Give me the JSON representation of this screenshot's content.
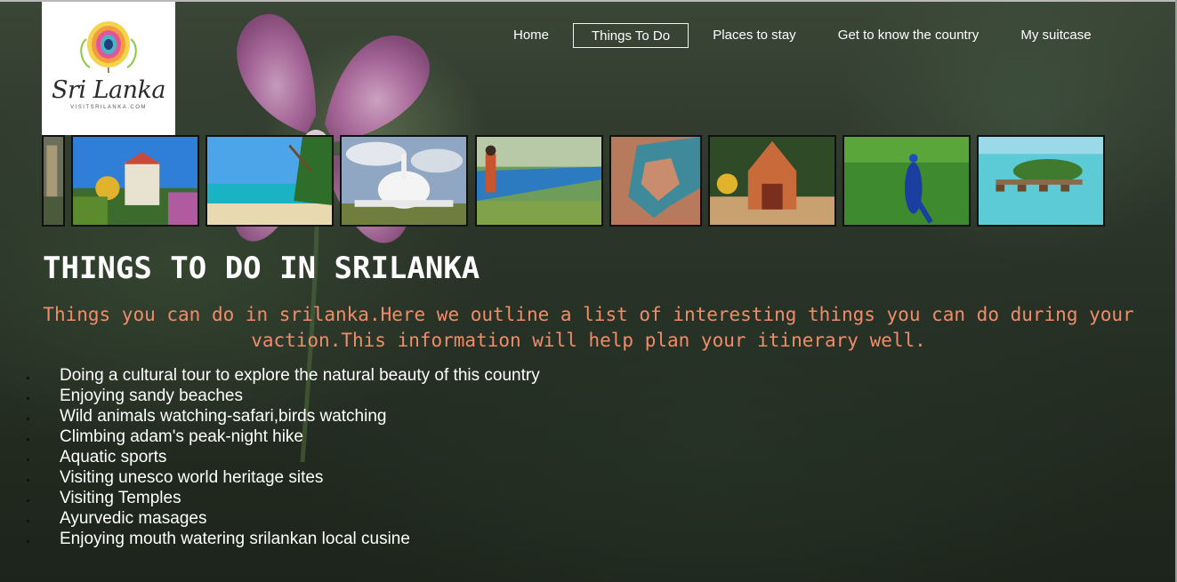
{
  "logo": {
    "brand": "Sri Lanka",
    "url": "VISITSRILANKA.COM",
    "feather_icon": "peacock-feather-icon"
  },
  "nav": {
    "items": [
      {
        "label": "Home",
        "active": false
      },
      {
        "label": "Things To Do",
        "active": true
      },
      {
        "label": "Places to stay",
        "active": false
      },
      {
        "label": "Get to know the country",
        "active": false
      },
      {
        "label": "My suitcase",
        "active": false
      }
    ]
  },
  "gallery": {
    "images": [
      "rock-carving-thumbnail",
      "golden-statue-temple-thumbnail",
      "beach-palms-thumbnail",
      "white-stupa-thumbnail",
      "blue-train-thumbnail",
      "galle-fort-aerial-thumbnail",
      "hindu-temple-thumbnail",
      "peacock-thumbnail",
      "island-resort-thumbnail"
    ]
  },
  "main": {
    "title": "THINGS TO DO IN SRILANKA",
    "intro": "Things you can do in srilanka.Here we outline a list of interesting things you can do during your vaction.This information will help plan your itinerary well.",
    "activities": [
      "Doing a cultural tour to explore the natural beauty of this country",
      "Enjoying sandy beaches",
      "Wild animals watching-safari,birds watching",
      "Climbing adam's peak-night hike",
      "Aquatic sports",
      "Visiting unesco world heritage sites",
      "Visiting Temples",
      "Ayurvedic masages",
      "Enjoying mouth watering srilankan local cusine"
    ]
  },
  "colors": {
    "accent_text": "#f08c6a",
    "title_text": "#ffffff",
    "background": "#1f2a1c"
  }
}
